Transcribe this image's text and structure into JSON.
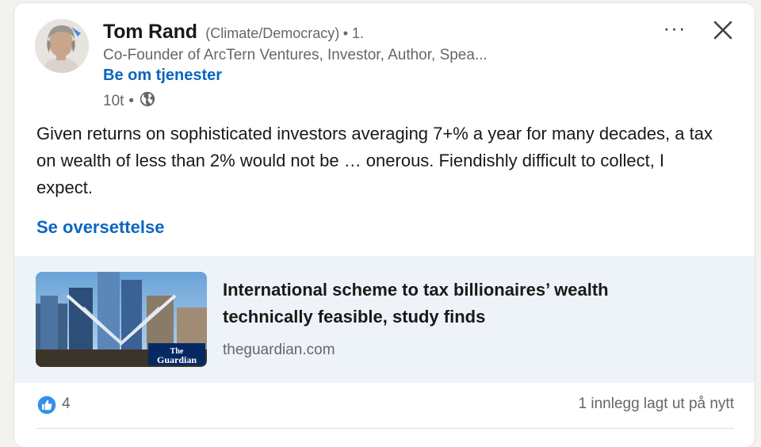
{
  "author": {
    "name": "Tom Rand",
    "pronouns": "(Climate/Democracy)",
    "degree": "• 1.",
    "headline": "Co-Founder of ArcTern Ventures, Investor, Author, Spea...",
    "service_link": "Be om tjenester",
    "time": "10t",
    "separator": "•",
    "visibility_icon": "globe-icon"
  },
  "actions": {
    "more_label": "···",
    "more_icon": "more-horizontal-icon",
    "close_icon": "close-icon"
  },
  "post": {
    "text": "Given returns on sophisticated investors averaging 7+% a year for many decades, a tax on wealth of less than 2% would not be … onerous. Fiendishly difficult to collect, I expect.",
    "translate_label": "Se oversettelse"
  },
  "link_preview": {
    "title": "International scheme to tax billionaires’ wealth technically feasible, study finds",
    "source": "theguardian.com",
    "thumbnail_watermark": "The Guardian"
  },
  "social": {
    "like_icon": "thumbs-up-icon",
    "like_count": "4",
    "repost_text": "1 innlegg lagt ut på nytt"
  },
  "colors": {
    "link_blue": "#0a66c2",
    "preview_bg": "#edf3f8",
    "like_blue": "#378fe9"
  }
}
